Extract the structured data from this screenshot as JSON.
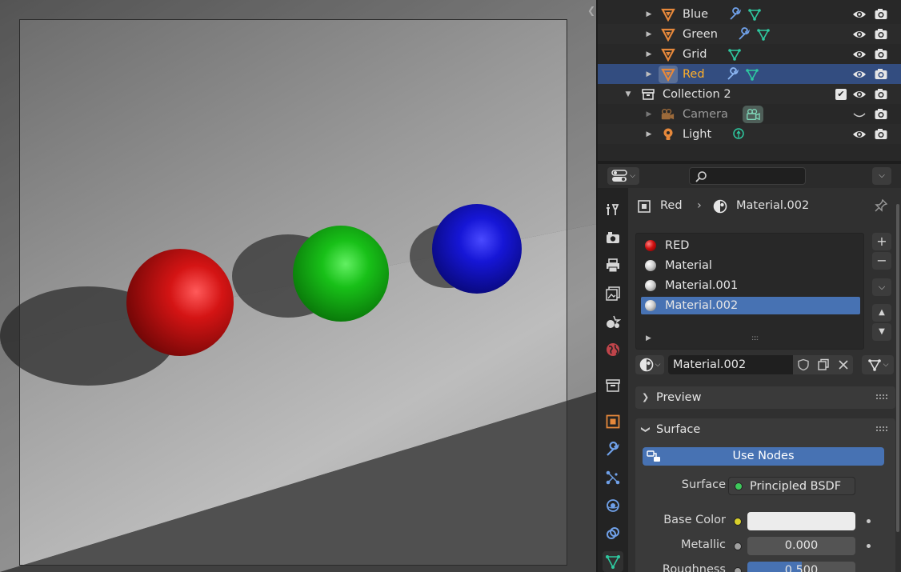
{
  "viewport": {
    "collapse_icon": "chevron-left-icon"
  },
  "outliner": {
    "rows": [
      {
        "name": "Blue",
        "type": "mesh"
      },
      {
        "name": "Green",
        "type": "mesh"
      },
      {
        "name": "Grid",
        "type": "mesh"
      },
      {
        "name": "Red",
        "type": "mesh",
        "selected": true
      },
      {
        "name": "Collection 2",
        "type": "collection"
      },
      {
        "name": "Camera",
        "type": "camera"
      },
      {
        "name": "Light",
        "type": "light"
      }
    ]
  },
  "properties": {
    "search_placeholder": "",
    "breadcrumb": {
      "object": "Red",
      "material": "Material.002"
    },
    "material_slots": [
      {
        "name": "RED",
        "color": "#d01010"
      },
      {
        "name": "Material",
        "color": "#dcdcdc"
      },
      {
        "name": "Material.001",
        "color": "#dcdcdc"
      },
      {
        "name": "Material.002",
        "color": "#dcdcdc",
        "selected": true
      }
    ],
    "material_name": "Material.002",
    "panels": {
      "preview": "Preview",
      "surface": "Surface"
    },
    "use_nodes_label": "Use Nodes",
    "surface_label": "Surface",
    "surface_value": "Principled BSDF",
    "base_color_label": "Base Color",
    "metallic_label": "Metallic",
    "metallic_value": "0.000",
    "roughness_label": "Roughness",
    "roughness_value": "0.500",
    "roughness_fraction": 0.5
  },
  "colors": {
    "accent": "#4772b3",
    "active_object": "#ffaf29",
    "socket_green": "#3ec95b",
    "socket_yellow": "#d9d02b",
    "socket_grey": "#a0a0a0"
  }
}
